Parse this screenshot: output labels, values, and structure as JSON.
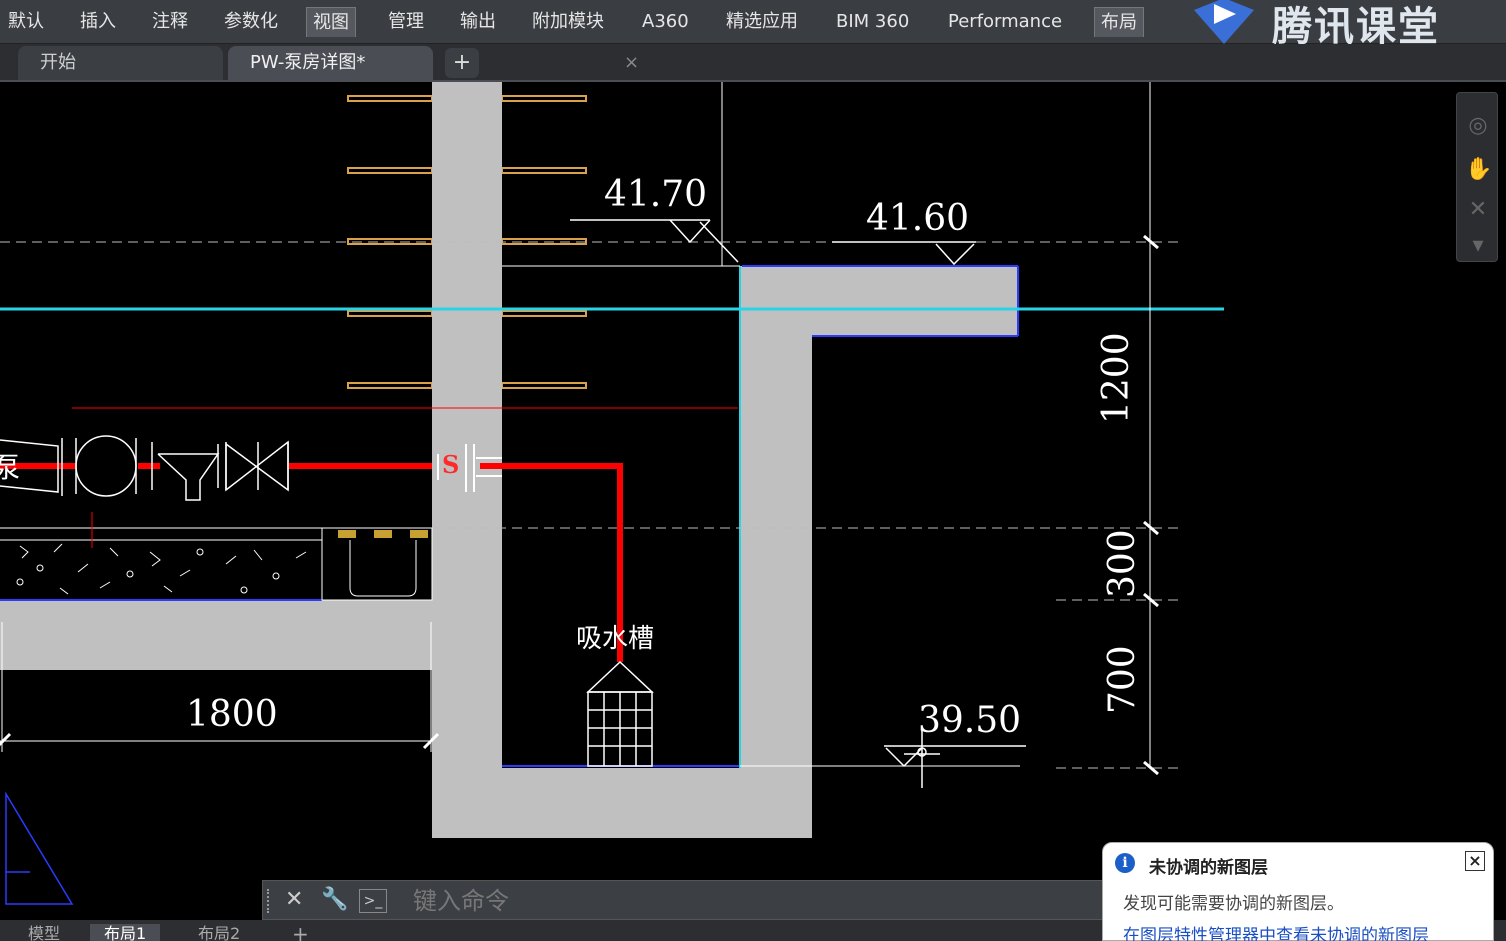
{
  "ribbon": {
    "tabs": [
      "默认",
      "插入",
      "注释",
      "参数化",
      "视图",
      "管理",
      "输出",
      "附加模块",
      "A360",
      "精选应用",
      "BIM 360",
      "Performance",
      "布局"
    ],
    "active_tab": "视图"
  },
  "logo": {
    "text": "腾讯课堂"
  },
  "file_tabs": {
    "start": "开始",
    "current": "PW-泵房详图*",
    "close_glyph": "×",
    "add_glyph": "+"
  },
  "drawing": {
    "elevations": {
      "top_left": "41.70",
      "top_right": "41.60",
      "bottom": "39.50"
    },
    "dimensions": {
      "horizontal": "1800",
      "d1": "1200",
      "d2": "300",
      "d3": "700"
    },
    "labels": {
      "suction_tank": "吸水槽",
      "pipe_marker": "S",
      "cut_left": "泵"
    }
  },
  "command_line": {
    "placeholder": "键入命令"
  },
  "layout_tabs": [
    "模型",
    "布局1",
    "布局2"
  ],
  "layout_add": "+",
  "notification": {
    "title": "未协调的新图层",
    "message": "发现可能需要协调的新图层。",
    "link": "在图层特性管理器中查看未协调的新图层",
    "close": "×"
  },
  "colors": {
    "wall": "#c0c0c0",
    "pipe": "#ff0000",
    "cyan_line": "#29d4e6",
    "ladder": "#d9a24a"
  }
}
